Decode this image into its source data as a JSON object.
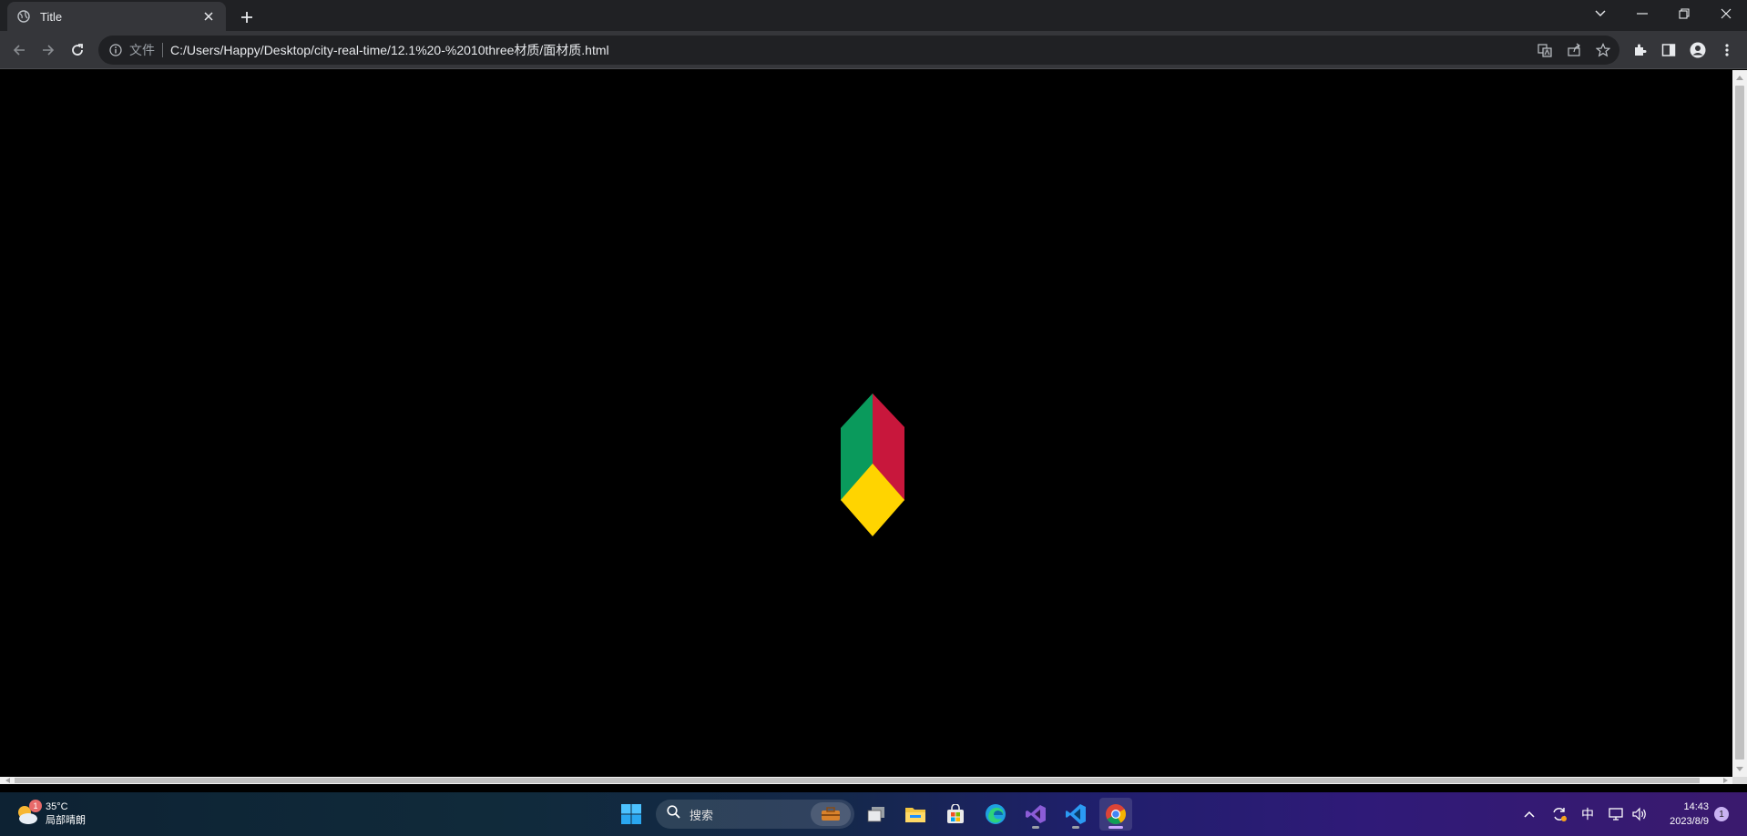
{
  "browser": {
    "tab": {
      "title": "Title"
    },
    "address": {
      "security_chip": "文件",
      "url": "C:/Users/Happy/Desktop/city-real-time/12.1%20-%2010three材质/面材质.html"
    }
  },
  "scene": {
    "cube_face_colors": {
      "left": "#0a9a5c",
      "right": "#c8173c",
      "bottom": "#ffd400"
    }
  },
  "taskbar": {
    "weather": {
      "badge": "1",
      "temp": "35°C",
      "condition": "局部晴朗"
    },
    "search_label": "搜索",
    "tray": {
      "ime": "中"
    },
    "clock": {
      "time": "14:43",
      "date": "2023/8/9"
    },
    "notification_count": "1"
  }
}
